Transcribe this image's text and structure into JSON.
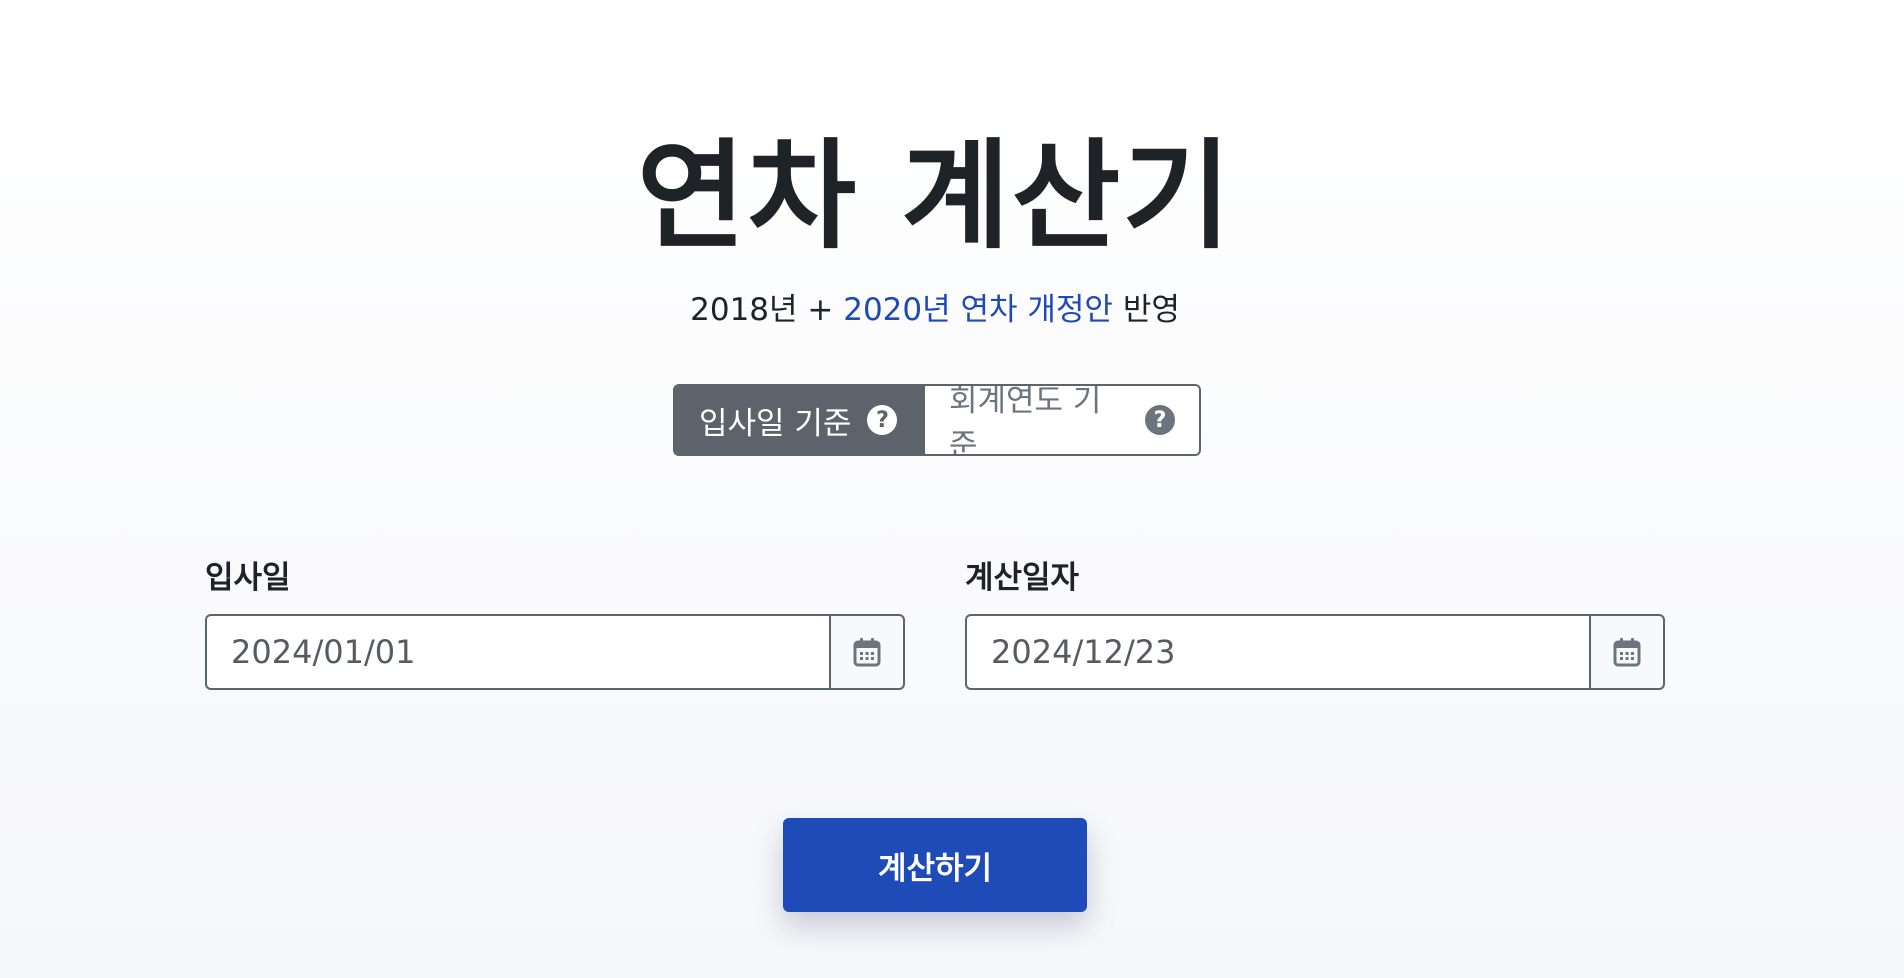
{
  "header": {
    "title": "연차 계산기",
    "subtitle_prefix": "2018년 + ",
    "subtitle_link": "2020년 연차 개정안",
    "subtitle_suffix": " 반영"
  },
  "mode_toggle": {
    "options": [
      {
        "label": "입사일 기준",
        "active": true,
        "icon": "question-circle-icon"
      },
      {
        "label": "회계연도 기준",
        "active": false,
        "icon": "question-circle-icon"
      }
    ],
    "help_glyph": "?"
  },
  "form": {
    "join_date": {
      "label": "입사일",
      "value": "2024/01/01",
      "icon": "calendar-icon"
    },
    "calc_date": {
      "label": "계산일자",
      "value": "2024/12/23",
      "icon": "calendar-icon"
    }
  },
  "actions": {
    "calculate_label": "계산하기"
  },
  "colors": {
    "primary": "#1e4bb8",
    "link": "#1d4ab7",
    "toggle_active": "#5c636a",
    "text": "#1f2226"
  }
}
